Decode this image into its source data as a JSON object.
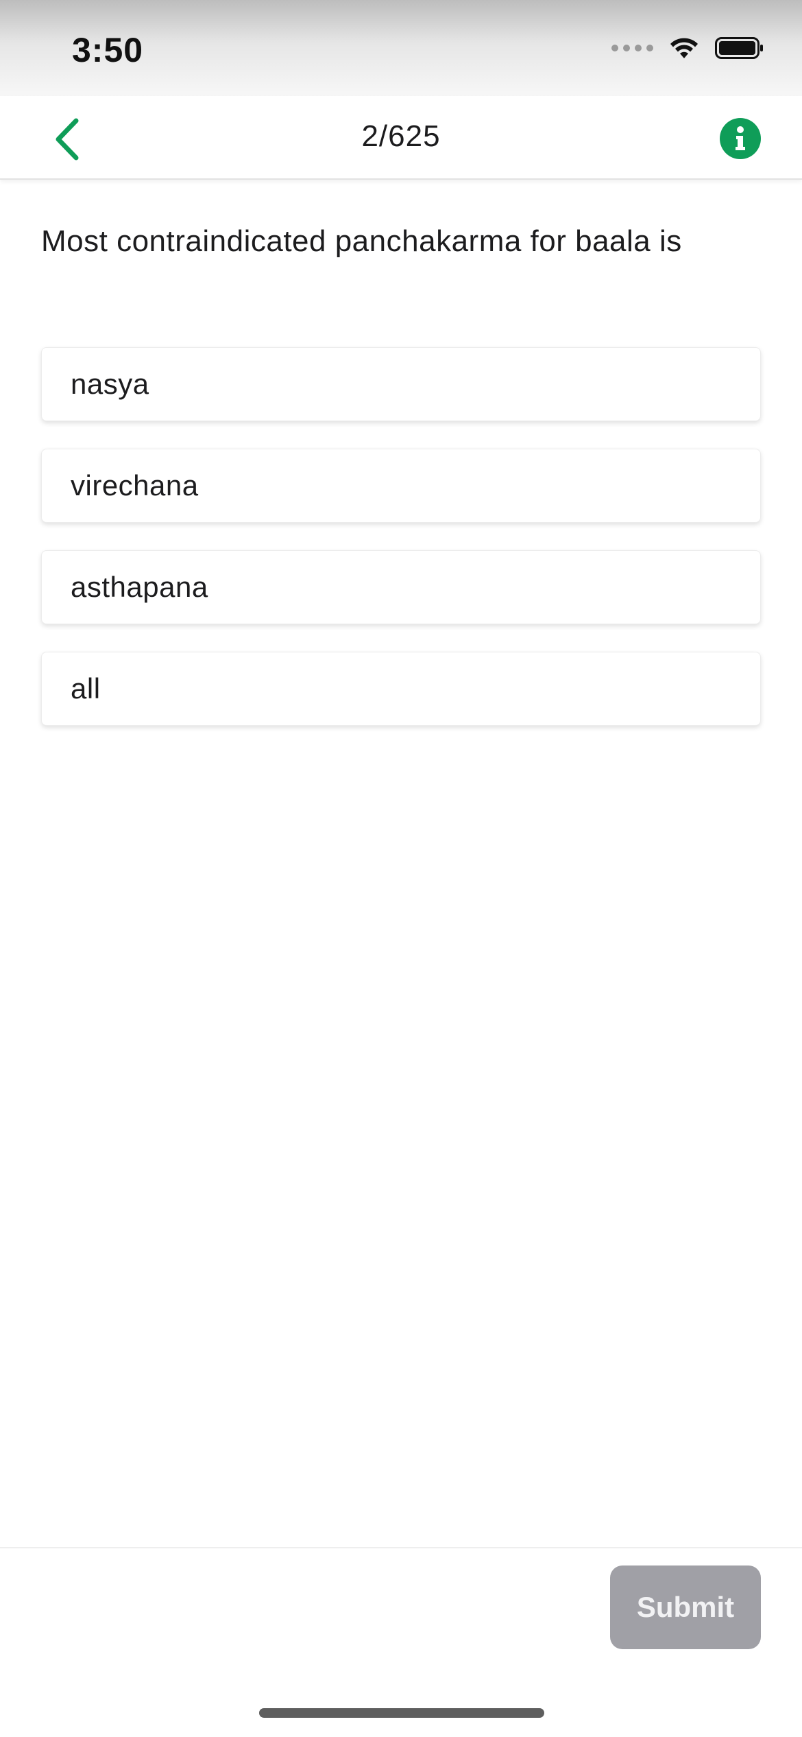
{
  "status_bar": {
    "time": "3:50"
  },
  "nav": {
    "progress": "2/625",
    "back_icon": "chevron-left-icon",
    "info_icon": "info-icon",
    "accent_color": "#0f9d58"
  },
  "question": {
    "text": "Most contraindicated panchakarma for baala is"
  },
  "options": [
    {
      "label": "nasya"
    },
    {
      "label": "virechana"
    },
    {
      "label": "asthapana"
    },
    {
      "label": "all"
    }
  ],
  "footer": {
    "submit_label": "Submit",
    "submit_color": "#a0a0a6"
  }
}
